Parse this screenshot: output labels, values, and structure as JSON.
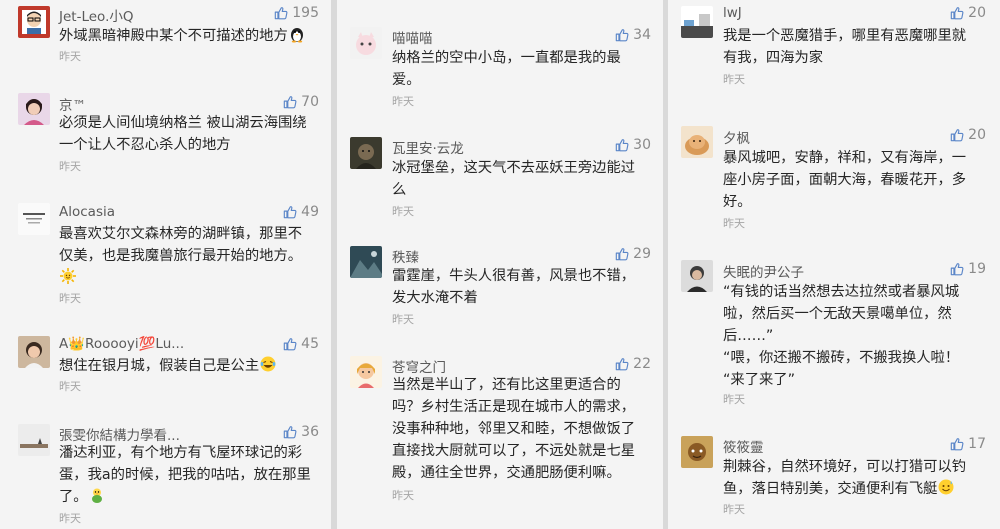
{
  "columns": [
    {
      "comments": [
        {
          "name": "Jet-Leo.小Q",
          "likes": "195",
          "time": "昨天",
          "lines": [
            "外域黑暗神殿中某个不可描述的地方"
          ],
          "emoji": "penguin-emoji"
        },
        {
          "name": "京™",
          "likes": "70",
          "time": "昨天",
          "lines": [
            "必须是人间仙境纳格兰 被山湖云海围绕",
            "一个让人不忍心杀人的地方"
          ]
        },
        {
          "name": "Alocasia",
          "likes": "49",
          "time": "昨天",
          "lines": [
            "最喜欢艾尔文森林旁的湖畔镇，那里不",
            "仅美，也是我魔兽旅行最开始的地方。"
          ],
          "emoji": "sun-emoji"
        },
        {
          "name": "A👑Rooooyi💯Lu...",
          "likes": "45",
          "time": "昨天",
          "lines": [
            "想住在银月城，假装自己是公主"
          ],
          "emoji": "laughing-tears-emoji"
        },
        {
          "name": "張雯你結構力學看...",
          "likes": "36",
          "time": "昨天",
          "lines": [
            "潘达利亚，有个地方有飞屋环球记的彩",
            "蛋，我a的时候，把我的咕咕，放在那里",
            "了。"
          ],
          "emoji": "chick-emoji"
        }
      ]
    },
    {
      "comments": [
        {
          "name": "喵喵喵",
          "likes": "34",
          "time": "昨天",
          "lines": [
            "纳格兰的空中小岛，一直都是我的最",
            "爱。"
          ]
        },
        {
          "name": "瓦里安·云龙",
          "likes": "30",
          "time": "昨天",
          "lines": [
            "冰冠堡垒，这天气不去巫妖王旁边能过",
            "么"
          ]
        },
        {
          "name": "秩臻",
          "likes": "29",
          "time": "昨天",
          "lines": [
            "雷霆崖，牛头人很有善，风景也不错，",
            "发大水淹不着"
          ]
        },
        {
          "name": "苍穹之门",
          "likes": "22",
          "time": "昨天",
          "lines": [
            "当然是半山了，还有比这里更适合的",
            "吗？乡村生活正是现在城市人的需求，",
            "没事种种地，邻里又和睦，不想做饭了",
            "直接找大厨就可以了，不远处就是七星",
            "殿，通往全世界，交通肥肠便利嘛。"
          ]
        }
      ]
    },
    {
      "comments": [
        {
          "name": "lwJ",
          "likes": "20",
          "time": "昨天",
          "lines": [
            "我是一个恶魔猎手，哪里有恶魔哪里就",
            "有我，四海为家"
          ]
        },
        {
          "name": "夕枫",
          "likes": "20",
          "time": "昨天",
          "lines": [
            "暴风城吧，安静，祥和，又有海岸，一",
            "座小房子面，面朝大海，春暖花开，多",
            "好。"
          ]
        },
        {
          "name": "失眠的尹公子",
          "likes": "19",
          "time": "昨天",
          "lines": [
            "“有钱的话当然想去达拉然或者暴风城",
            "啦，然后买一个无敌天景噶单位，然",
            "后……”",
            "“喂，你还搬不搬砖，不搬我换人啦！",
            "“来了来了”"
          ]
        },
        {
          "name": "筱筱靈",
          "likes": "17",
          "time": "昨天",
          "lines": [
            "荆棘谷，自然环境好，可以打猎可以钓",
            "鱼，落日特别美，交通便利有飞艇"
          ],
          "emoji": "sweat-smile-emoji"
        }
      ]
    }
  ],
  "colors": {
    "page_bg": "#f4f4f4",
    "divider": "#d9d9d9",
    "name": "#5a5a5a",
    "likes": "#8a8a8a",
    "time": "#a5a5a5",
    "like_icon": "#5b86c8"
  },
  "icons": {
    "like": "thumbs-up-icon"
  }
}
